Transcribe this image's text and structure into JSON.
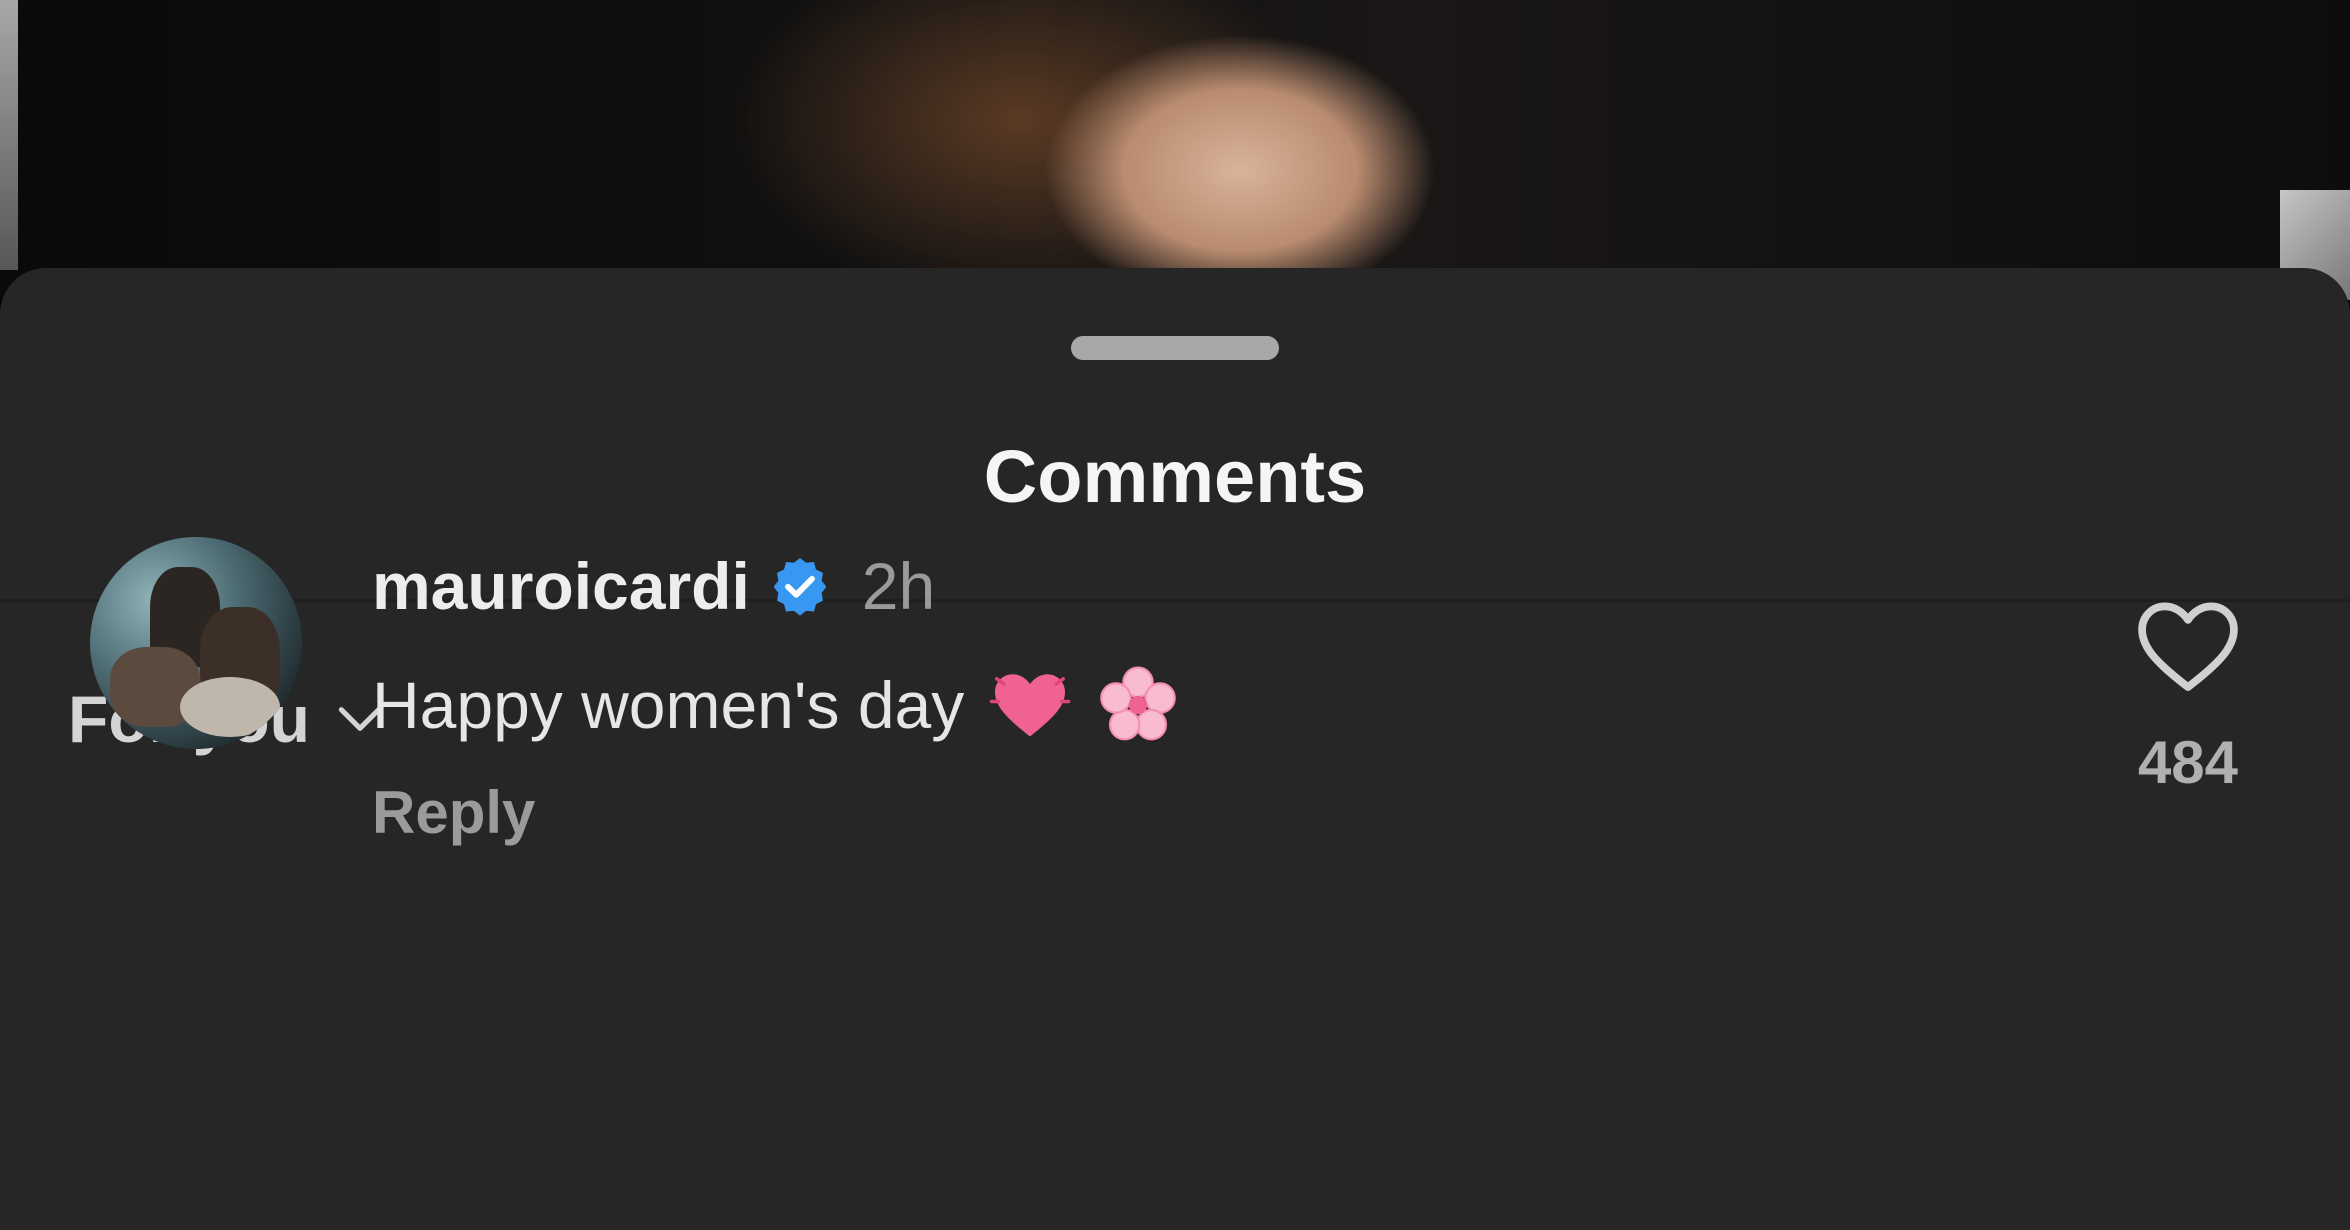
{
  "sheet": {
    "title": "Comments"
  },
  "sort": {
    "label": "For you"
  },
  "comment": {
    "username": "mauroicardi",
    "timestamp": "2h",
    "text": "Happy women's day",
    "emojis": [
      "heart-emoji",
      "cherry-blossom-emoji"
    ],
    "reply_label": "Reply",
    "like_count": "484"
  },
  "colors": {
    "sheet_bg": "#262626",
    "verified_blue": "#3897f0",
    "heart_pink": "#f06292",
    "flower_pink": "#f8bbd0"
  }
}
